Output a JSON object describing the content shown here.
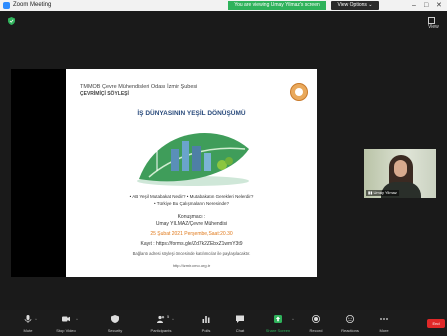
{
  "window": {
    "title": "Zoom Meeting",
    "controls": {
      "minimize": "–",
      "maximize": "□",
      "close": "✕"
    }
  },
  "banner": {
    "text": "You are viewing Umay Yilmaz's screen",
    "view_options": "View Options ⌄"
  },
  "topbar": {
    "view_label": "View"
  },
  "slide": {
    "org_line1": "TMMOB Çevre Mühendisleri Odası  İzmir Şubesi",
    "org_line2": "ÇEVRİMİÇİ SÖYLEŞİ",
    "topic": "İŞ DÜNYASININ YEŞİL DÖNÜŞÜMÜ",
    "bullets": "• AB Yeşil Mutabakat Nedir? • Mutabakatın Gerekleri Nelerdir?\n• Türkiye Bu Çalışmaların Neresinde?",
    "speaker_label": "Konuşmacı :",
    "speaker_name": "Umay YILMAZ/Çevre Mühendisi",
    "date": "25 Şubat 2021 Perşembe,Saat:20.30",
    "registration": "Kayıt : https://forms.gle/Zd7k2ZEbxZ1wmY3t9",
    "note": "Bağlantı adresi söyleşi  öncesinde katılımcılar ile paylaşılacaktır.",
    "website": "http://izmir.cmo.org.tr"
  },
  "participant": {
    "name": "Umay Yilmaz"
  },
  "toolbar": {
    "items": [
      {
        "label": "Mute",
        "icon": "microphone-icon"
      },
      {
        "label": "Stop Video",
        "icon": "video-camera-icon"
      },
      {
        "label": "Security",
        "icon": "shield-icon"
      },
      {
        "label": "Participants",
        "icon": "participants-icon",
        "count": "5"
      },
      {
        "label": "Polls",
        "icon": "polls-icon"
      },
      {
        "label": "Chat",
        "icon": "chat-icon"
      },
      {
        "label": "Share Screen",
        "icon": "share-screen-icon"
      },
      {
        "label": "Record",
        "icon": "record-icon"
      },
      {
        "label": "Reactions",
        "icon": "reactions-icon"
      },
      {
        "label": "More",
        "icon": "more-icon"
      }
    ],
    "end_label": "End"
  },
  "colors": {
    "banner_green": "#2fb25b",
    "share_green": "#2fb25b",
    "end_red": "#e02828",
    "slide_accent_orange": "#e07a1c",
    "slide_title_blue": "#2a4b7c"
  }
}
